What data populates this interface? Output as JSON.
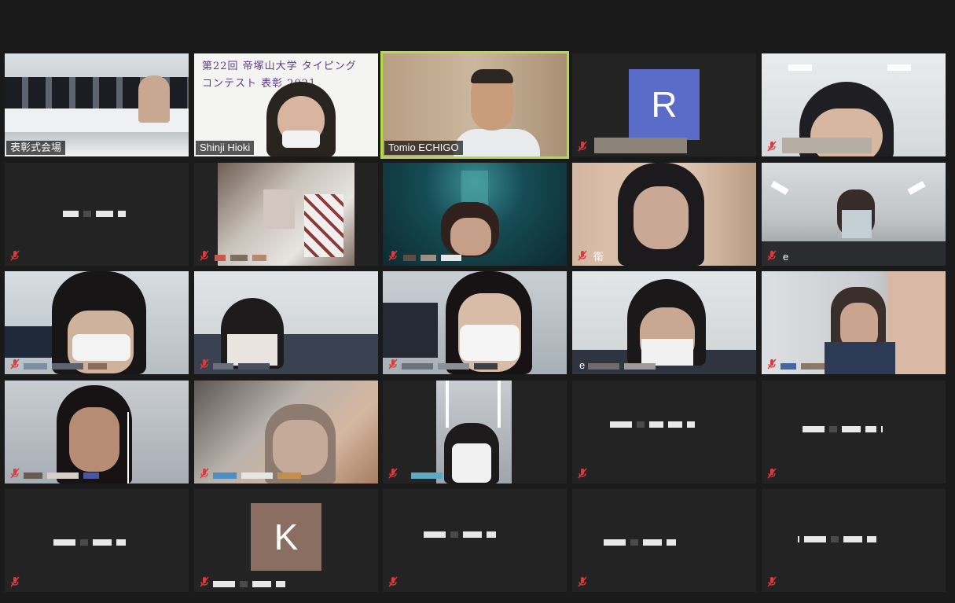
{
  "tiles": [
    {
      "id": "t1",
      "name": "表彰式会場",
      "kind": "video",
      "muted": false,
      "active": false
    },
    {
      "id": "t2",
      "name": "Shinji Hioki",
      "kind": "video",
      "muted": false,
      "active": false,
      "board_text": "第22回 帝塚山大学 タイピングコンテスト 表彰 2021"
    },
    {
      "id": "t3",
      "name": "Tomio ECHIGO",
      "kind": "video",
      "muted": false,
      "active": true
    },
    {
      "id": "t4",
      "name": "",
      "kind": "avatar",
      "avatar_letter": "R",
      "avatar_color": "#5a6bc8",
      "muted": true
    },
    {
      "id": "t5",
      "name": "",
      "kind": "video",
      "muted": true
    },
    {
      "id": "t6",
      "name": "",
      "kind": "blank",
      "muted": true
    },
    {
      "id": "t7",
      "name": "",
      "kind": "video",
      "muted": true
    },
    {
      "id": "t8",
      "name": "",
      "kind": "video",
      "muted": true
    },
    {
      "id": "t9",
      "name": "衛",
      "kind": "video",
      "muted": true
    },
    {
      "id": "t10",
      "name": "e",
      "kind": "video",
      "muted": true
    },
    {
      "id": "t11",
      "name": "",
      "kind": "video",
      "muted": true
    },
    {
      "id": "t12",
      "name": "",
      "kind": "video",
      "muted": true
    },
    {
      "id": "t13",
      "name": "",
      "kind": "video",
      "muted": true
    },
    {
      "id": "t14",
      "name": "e",
      "kind": "video",
      "muted": false
    },
    {
      "id": "t15",
      "name": "",
      "kind": "video",
      "muted": true
    },
    {
      "id": "t16",
      "name": "",
      "kind": "video",
      "muted": true
    },
    {
      "id": "t17",
      "name": "",
      "kind": "video",
      "muted": true
    },
    {
      "id": "t18",
      "name": "",
      "kind": "video",
      "muted": true
    },
    {
      "id": "t19",
      "name": "",
      "kind": "blank",
      "muted": true
    },
    {
      "id": "t20",
      "name": "",
      "kind": "blank",
      "muted": true
    },
    {
      "id": "t21",
      "name": "",
      "kind": "blank",
      "muted": true
    },
    {
      "id": "t22",
      "name": "",
      "kind": "avatar",
      "avatar_letter": "K",
      "avatar_color": "#8a6e62",
      "muted": true
    },
    {
      "id": "t23",
      "name": "",
      "kind": "blank",
      "muted": true
    },
    {
      "id": "t24",
      "name": "",
      "kind": "blank",
      "muted": true
    },
    {
      "id": "t25",
      "name": "",
      "kind": "blank",
      "muted": true
    }
  ],
  "colors": {
    "active_border": "#b3db48",
    "mute_icon": "#e0383d",
    "tile_bg": "#232323",
    "window_bg": "#1a1a1a"
  },
  "icons": {
    "mute": "mic-muted-icon"
  }
}
